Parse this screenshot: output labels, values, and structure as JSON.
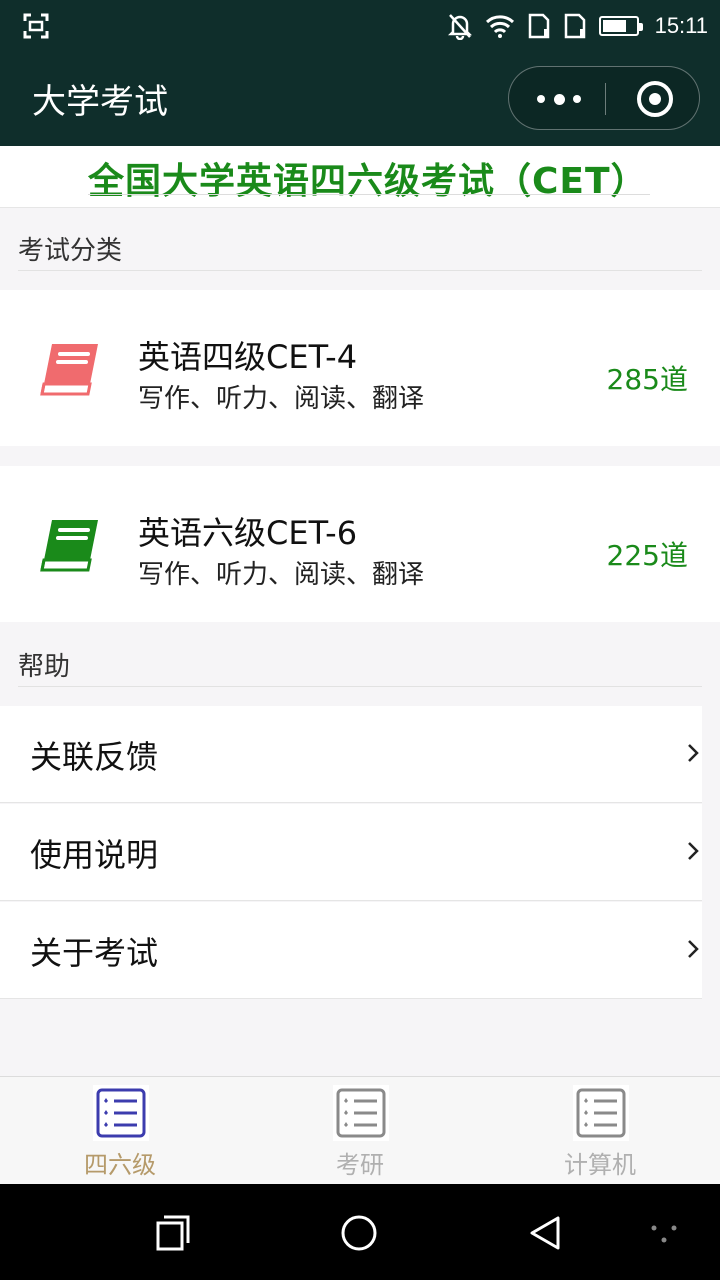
{
  "status_bar": {
    "time": "15:11",
    "battery_level": 0.72,
    "icons": [
      "screenshot-icon",
      "notification-off-icon",
      "wifi-icon",
      "sim1-icon",
      "sim2-icon",
      "battery-icon"
    ]
  },
  "nav": {
    "title": "大学考试",
    "icons": [
      "more-icon",
      "close-target-icon"
    ]
  },
  "banner": {
    "title": "全国大学英语四六级考试（CET）",
    "color": "#1a8a1a"
  },
  "sections": {
    "exam_category": "考试分类",
    "help": "帮助"
  },
  "exams": [
    {
      "name": "英语四级CET-4",
      "desc": "写作、听力、阅读、翻译",
      "count": "285道",
      "icon": "red-book-icon",
      "color": "#f06b6e"
    },
    {
      "name": "英语六级CET-6",
      "desc": "写作、听力、阅读、翻译",
      "count": "225道",
      "icon": "green-book-icon",
      "color": "#1a8a1a"
    }
  ],
  "help_items": [
    {
      "label": "关联反馈"
    },
    {
      "label": "使用说明"
    },
    {
      "label": "关于考试"
    }
  ],
  "tabs": [
    {
      "label": "四六级",
      "active": true,
      "color": "#b59a6a",
      "icon_color": "#3c3cae"
    },
    {
      "label": "考研",
      "active": false,
      "color": "#b0b0b0",
      "icon_color": "#8a8a8a"
    },
    {
      "label": "计算机",
      "active": false,
      "color": "#b0b0b0",
      "icon_color": "#8a8a8a"
    }
  ],
  "system_nav": {
    "icons": [
      "recent-apps-icon",
      "home-icon",
      "back-icon",
      "assistant-dots-icon"
    ]
  }
}
